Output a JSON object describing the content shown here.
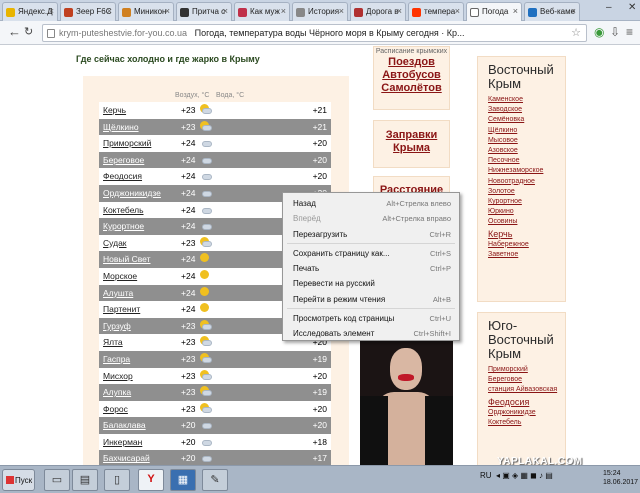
{
  "tabs": [
    {
      "label": "Яндекс.Д",
      "color": "#e8b400"
    },
    {
      "label": "Зеер F6C",
      "color": "#c04020"
    },
    {
      "label": "Миникон",
      "color": "#d08020"
    },
    {
      "label": "Притча с",
      "color": "#333333"
    },
    {
      "label": "Как муж",
      "color": "#c0304a"
    },
    {
      "label": "История",
      "color": "#888888"
    },
    {
      "label": "Дорога в",
      "color": "#b03030"
    },
    {
      "label": "темпера",
      "color": "#ff3300"
    },
    {
      "label": "Погода",
      "color": "#ffffff"
    },
    {
      "label": "Веб-каме",
      "color": "#2070c0"
    }
  ],
  "active_tab": 8,
  "address": {
    "url": "krym-puteshestvie.for-you.co.ua",
    "title": "Погода, температура воды Чёрного моря в Крыму сегодня · Кр..."
  },
  "heading": "Где сейчас холодно и где жарко в Крыму",
  "table": {
    "col_air": "Воздух, °С",
    "col_water": "Вода, °С",
    "rows": [
      {
        "city": "Керчь",
        "air": "+23",
        "water": "+21",
        "icon": "sun-cloud"
      },
      {
        "city": "Щёлкино",
        "air": "+23",
        "water": "+21",
        "icon": "sun-cloud"
      },
      {
        "city": "Приморский",
        "air": "+24",
        "water": "+20",
        "icon": "cloud"
      },
      {
        "city": "Береговое",
        "air": "+24",
        "water": "+20",
        "icon": "cloud"
      },
      {
        "city": "Феодосия",
        "air": "+24",
        "water": "+20",
        "icon": "cloud"
      },
      {
        "city": "Орджоникидзе",
        "air": "+24",
        "water": "+20",
        "icon": "cloud"
      },
      {
        "city": "Коктебель",
        "air": "+24",
        "water": "+20",
        "icon": "cloud"
      },
      {
        "city": "Курортное",
        "air": "+24",
        "water": "+20",
        "icon": "cloud"
      },
      {
        "city": "Судак",
        "air": "+23",
        "water": "+20",
        "icon": "sun-cloud"
      },
      {
        "city": "Новый Свет",
        "air": "+24",
        "water": "+20",
        "icon": "sun"
      },
      {
        "city": "Морское",
        "air": "+24",
        "water": "+20",
        "icon": "sun"
      },
      {
        "city": "Алушта",
        "air": "+24",
        "water": "+20",
        "icon": "sun"
      },
      {
        "city": "Партенит",
        "air": "+24",
        "water": "+20",
        "icon": "sun"
      },
      {
        "city": "Гурзуф",
        "air": "+23",
        "water": "+19",
        "icon": "sun-cloud"
      },
      {
        "city": "Ялта",
        "air": "+23",
        "water": "+20",
        "icon": "sun-cloud"
      },
      {
        "city": "Гаспра",
        "air": "+23",
        "water": "+19",
        "icon": "sun-cloud"
      },
      {
        "city": "Мисхор",
        "air": "+23",
        "water": "+20",
        "icon": "sun-cloud"
      },
      {
        "city": "Алупка",
        "air": "+23",
        "water": "+19",
        "icon": "sun-cloud"
      },
      {
        "city": "Форос",
        "air": "+23",
        "water": "+20",
        "icon": "sun-cloud"
      },
      {
        "city": "Балаклава",
        "air": "+20",
        "water": "+20",
        "icon": "cloud"
      },
      {
        "city": "Инкерман",
        "air": "+20",
        "water": "+18",
        "icon": "cloud"
      },
      {
        "city": "Бахчисарай",
        "air": "+20",
        "water": "+17",
        "icon": "cloud"
      }
    ]
  },
  "mid": {
    "box1_small": "Расписание крымских",
    "box1_links": [
      "Поездов",
      "Автобусов",
      "Самолётов"
    ],
    "box2_links": [
      "Заправки",
      "Крыма"
    ],
    "box3_links": [
      "Расстояние"
    ]
  },
  "right": {
    "east_title": "Восточный Крым",
    "east_links": [
      "Каменское",
      "Заводское",
      "Семёновка",
      "Щёлкино",
      "Мысовое",
      "Азовское",
      "Песочное",
      "Нижнезаморское",
      "Новоотрадное",
      "Золотое",
      "Курортное",
      "Юркино",
      "Осовины"
    ],
    "east_big": "Керчь",
    "east_links2": [
      "Набережное",
      "Заветное"
    ],
    "south_title": "Юго-Восточный Крым",
    "south_links": [
      "Приморский",
      "Береговое",
      "станция Айвазовская"
    ],
    "south_big": "Феодосия",
    "south_links2": [
      "Орджоникидзе",
      "Коктебель"
    ]
  },
  "context_menu": [
    {
      "label": "Назад",
      "shortcut": "Alt+Стрелка влево",
      "disabled": false
    },
    {
      "label": "Вперёд",
      "shortcut": "Alt+Стрелка вправо",
      "disabled": true
    },
    {
      "label": "Перезагрузить",
      "shortcut": "Ctrl+R",
      "disabled": false
    },
    {
      "sep": true
    },
    {
      "label": "Сохранить страницу как...",
      "shortcut": "Ctrl+S",
      "disabled": false
    },
    {
      "label": "Печать",
      "shortcut": "Ctrl+P",
      "disabled": false
    },
    {
      "label": "Перевести на русский",
      "shortcut": "",
      "disabled": false
    },
    {
      "label": "Перейти в режим чтения",
      "shortcut": "Alt+B",
      "disabled": false
    },
    {
      "sep": true
    },
    {
      "label": "Просмотреть код страницы",
      "shortcut": "Ctrl+U",
      "disabled": false
    },
    {
      "label": "Исследовать элемент",
      "shortcut": "Ctrl+Shift+I",
      "disabled": false
    }
  ],
  "taskbar": {
    "start_label": "Пуск",
    "lang": "RU",
    "time": "15:24",
    "date": "18.06.2017"
  },
  "watermark": "YAPLAKAL.COM"
}
